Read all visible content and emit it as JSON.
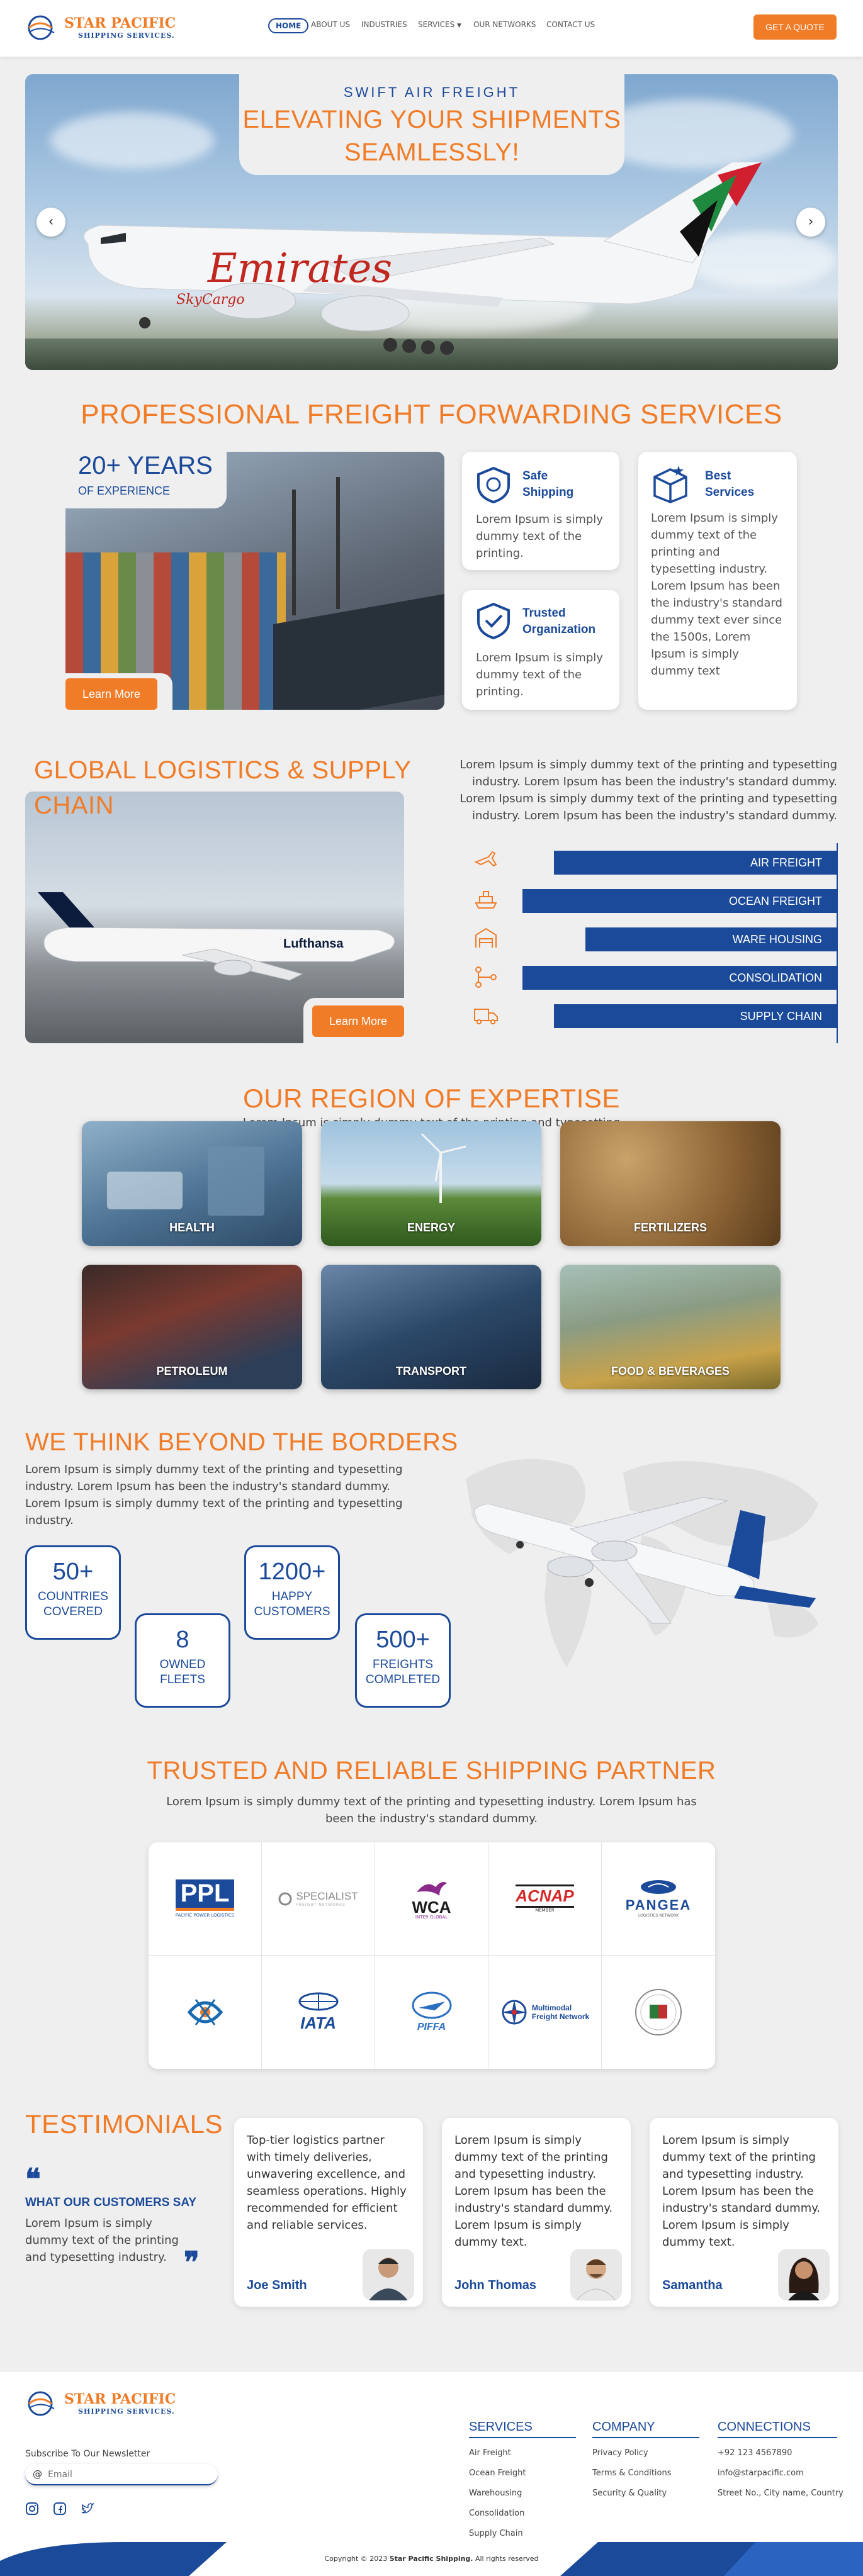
{
  "brand": {
    "name": "STAR PACIFIC",
    "sub": "SHIPPING SERVICES."
  },
  "nav": {
    "home": "HOME",
    "about": "ABOUT US",
    "industries": "INDUSTRIES",
    "services": "SERVICES",
    "networks": "OUR NETWORKS",
    "contact": "CONTACT US",
    "quote": "GET A QUOTE"
  },
  "hero": {
    "eyebrow": "SWIFT AIR FREIGHT",
    "title_line1": "ELEVATING YOUR SHIPMENTS",
    "title_line2": "SEAMLESSLY!",
    "plane_text": "Emirates",
    "plane_sub": "SkyCargo"
  },
  "services_section": {
    "title": "PROFESSIONAL FREIGHT FORWARDING SERVICES",
    "years": "20+ YEARS",
    "years_sub": "OF EXPERIENCE",
    "learn_more": "Learn More",
    "cards": [
      {
        "title_l1": "Safe",
        "title_l2": "Shipping",
        "text": "Lorem Ipsum is simply dummy text of the printing."
      },
      {
        "title_l1": "Trusted",
        "title_l2": "Organization",
        "text": "Lorem Ipsum is simply dummy text of the printing."
      },
      {
        "title_l1": "Best",
        "title_l2": "Services",
        "text": "Lorem Ipsum is simply dummy text of the printing and typesetting industry. Lorem Ipsum has been the industry's standard dummy text ever since the 1500s, Lorem Ipsum is simply dummy text"
      }
    ]
  },
  "logistics": {
    "title_l1": "GLOBAL LOGISTICS & SUPPLY",
    "title_l2": "CHAIN",
    "text": "Lorem Ipsum is simply dummy text of the printing and typesetting industry. Lorem Ipsum has been the industry's standard dummy. Lorem Ipsum is simply dummy text of the printing and typesetting industry. Lorem Ipsum has been the industry's standard dummy.",
    "learn_more": "Learn More",
    "plane_text": "Lufthansa",
    "bars": [
      {
        "label": "AIR FREIGHT",
        "icon": "airplane-icon"
      },
      {
        "label": "OCEAN FREIGHT",
        "icon": "ship-icon"
      },
      {
        "label": "WARE HOUSING",
        "icon": "warehouse-icon"
      },
      {
        "label": "CONSOLIDATION",
        "icon": "consolidation-icon"
      },
      {
        "label": "SUPPLY CHAIN",
        "icon": "truck-icon"
      }
    ]
  },
  "expertise": {
    "title": "OUR REGION OF EXPERTISE",
    "subtitle": "Lorem Ipsum is simply dummy text of the printing and typesetting",
    "tiles": [
      "HEALTH",
      "ENERGY",
      "FERTILIZERS",
      "PETROLEUM",
      "TRANSPORT",
      "FOOD & BEVERAGES"
    ]
  },
  "borders": {
    "title": "WE THINK BEYOND THE BORDERS",
    "text": "Lorem Ipsum is simply dummy text of the printing and typesetting industry. Lorem Ipsum has been the industry's standard dummy. Lorem Ipsum is simply dummy text of the printing and typesetting industry.",
    "stats": [
      {
        "n": "50+",
        "l1": "COUNTRIES",
        "l2": "COVERED"
      },
      {
        "n": "8",
        "l1": "OWNED",
        "l2": "FLEETS"
      },
      {
        "n": "1200+",
        "l1": "HAPPY",
        "l2": "CUSTOMERS"
      },
      {
        "n": "500+",
        "l1": "FREIGHTS",
        "l2": "COMPLETED"
      }
    ]
  },
  "partners": {
    "title": "TRUSTED AND RELIABLE SHIPPING PARTNER",
    "text": "Lorem Ipsum is simply dummy text of the printing and typesetting industry. Lorem Ipsum has been the industry's standard dummy.",
    "logos": [
      {
        "name": "PPL",
        "sub": "PACIFIC POWER LOGISTICS",
        "color": "#1b4a9a"
      },
      {
        "name": "SPECIALIST",
        "sub": "FREIGHT NETWORKS",
        "color": "#8a8a8a"
      },
      {
        "name": "WCA",
        "sub": "INTER GLOBAL",
        "color": "#1b1b1b"
      },
      {
        "name": "ACNAP",
        "sub": "MEMBER",
        "color": "#d42a2a"
      },
      {
        "name": "PANGEA",
        "sub": "LOGISTICS NETWORK",
        "color": "#1b4a9a"
      },
      {
        "name": "",
        "sub": "",
        "color": "#1b6ab0"
      },
      {
        "name": "IATA",
        "sub": "",
        "color": "#1b4a9a"
      },
      {
        "name": "PIFFA",
        "sub": "",
        "color": "#2a6fc0"
      },
      {
        "name": "Multimodal",
        "sub": "Freight Network",
        "color": "#1b4a9a"
      },
      {
        "name": "",
        "sub": "",
        "color": "#2a7a3a"
      }
    ]
  },
  "testimonials": {
    "title": "TESTIMONIALS",
    "tag": "WHAT OUR CUSTOMERS SAY",
    "intro": "Lorem Ipsum is simply dummy text of the printing and typesetting industry.",
    "items": [
      {
        "text": "Top-tier logistics partner with timely deliveries, unwavering excellence, and seamless operations. Highly recommended for efficient and reliable services.",
        "name": "Joe Smith"
      },
      {
        "text": "Lorem Ipsum is simply dummy text of the printing and typesetting industry. Lorem Ipsum has been the industry's standard dummy. Lorem Ipsum is simply dummy text.",
        "name": "John Thomas"
      },
      {
        "text": "Lorem Ipsum is simply dummy text of the printing and typesetting industry. Lorem Ipsum has been the industry's standard dummy. Lorem Ipsum is simply dummy text.",
        "name": "Samantha"
      }
    ]
  },
  "footer": {
    "newsletter": "Subscribe To Our Newsletter",
    "email_placeholder": "Email",
    "services_title": "SERVICES",
    "services": [
      "Air Freight",
      "Ocean Freight",
      "Warehousing",
      "Consolidation",
      "Supply Chain"
    ],
    "company_title": "COMPANY",
    "company": [
      "Privacy Policy",
      "Terms & Conditions",
      "Security & Quality"
    ],
    "connections_title": "CONNECTIONS",
    "connections": [
      "+92 123 4567890",
      "info@starpacific.com",
      "Street No., City name, Country"
    ],
    "copyright_pre": "Copyright ",
    "copyright_year": "© 2023 ",
    "copyright_brand": "Star Pacific Shipping.",
    "copyright_post": " All rights reserved"
  }
}
